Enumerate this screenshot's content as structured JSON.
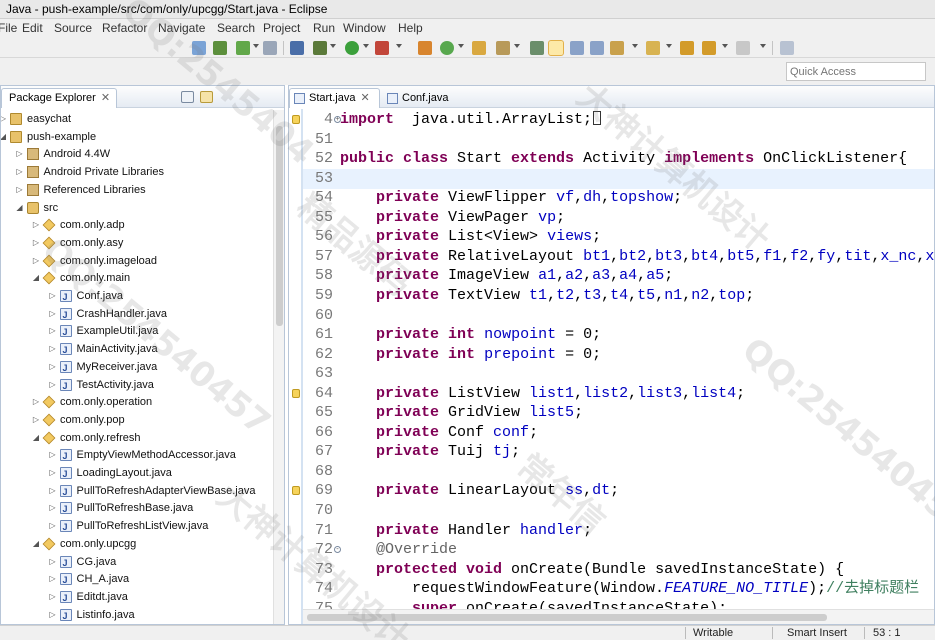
{
  "window": {
    "title": "Java - push-example/src/com/only/upcgg/Start.java - Eclipse"
  },
  "menu": [
    "File",
    "Edit",
    "Source",
    "Refactor",
    "Navigate",
    "Search",
    "Project",
    "Run",
    "Window",
    "Help"
  ],
  "toolbar": {
    "quick_access_placeholder": "Quick Access"
  },
  "package_explorer": {
    "tab_label": "Package Explorer",
    "close_glyph": "✕",
    "tree": [
      {
        "label": "easychat",
        "depth": 0,
        "icon": "project-icon",
        "expanded": false
      },
      {
        "label": "push-example",
        "depth": 0,
        "icon": "project-icon",
        "expanded": true
      },
      {
        "label": "Android 4.4W",
        "depth": 1,
        "icon": "library-icon",
        "expanded": false
      },
      {
        "label": "Android Private Libraries",
        "depth": 1,
        "icon": "library-icon",
        "expanded": false
      },
      {
        "label": "Referenced Libraries",
        "depth": 1,
        "icon": "library-icon",
        "expanded": false
      },
      {
        "label": "src",
        "depth": 1,
        "icon": "source-folder-icon",
        "expanded": true
      },
      {
        "label": "com.only.adp",
        "depth": 2,
        "icon": "package-icon",
        "expanded": false
      },
      {
        "label": "com.only.asy",
        "depth": 2,
        "icon": "package-icon",
        "expanded": false
      },
      {
        "label": "com.only.imageload",
        "depth": 2,
        "icon": "package-icon",
        "expanded": false
      },
      {
        "label": "com.only.main",
        "depth": 2,
        "icon": "package-icon",
        "expanded": true
      },
      {
        "label": "Conf.java",
        "depth": 3,
        "icon": "java-file-icon",
        "expanded": false
      },
      {
        "label": "CrashHandler.java",
        "depth": 3,
        "icon": "java-file-icon",
        "expanded": false
      },
      {
        "label": "ExampleUtil.java",
        "depth": 3,
        "icon": "java-file-icon",
        "expanded": false
      },
      {
        "label": "MainActivity.java",
        "depth": 3,
        "icon": "java-file-icon",
        "expanded": false
      },
      {
        "label": "MyReceiver.java",
        "depth": 3,
        "icon": "java-file-icon",
        "expanded": false
      },
      {
        "label": "TestActivity.java",
        "depth": 3,
        "icon": "java-file-icon",
        "expanded": false
      },
      {
        "label": "com.only.operation",
        "depth": 2,
        "icon": "package-icon",
        "expanded": false
      },
      {
        "label": "com.only.pop",
        "depth": 2,
        "icon": "package-icon",
        "expanded": false
      },
      {
        "label": "com.only.refresh",
        "depth": 2,
        "icon": "package-icon",
        "expanded": true
      },
      {
        "label": "EmptyViewMethodAccessor.java",
        "depth": 3,
        "icon": "java-file-icon",
        "expanded": false
      },
      {
        "label": "LoadingLayout.java",
        "depth": 3,
        "icon": "java-file-icon",
        "expanded": false
      },
      {
        "label": "PullToRefreshAdapterViewBase.java",
        "depth": 3,
        "icon": "java-file-icon",
        "expanded": false
      },
      {
        "label": "PullToRefreshBase.java",
        "depth": 3,
        "icon": "java-file-icon",
        "expanded": false
      },
      {
        "label": "PullToRefreshListView.java",
        "depth": 3,
        "icon": "java-file-icon",
        "expanded": false
      },
      {
        "label": "com.only.upcgg",
        "depth": 2,
        "icon": "package-icon",
        "expanded": true
      },
      {
        "label": "CG.java",
        "depth": 3,
        "icon": "java-file-icon",
        "expanded": false
      },
      {
        "label": "CH_A.java",
        "depth": 3,
        "icon": "java-file-icon",
        "expanded": false
      },
      {
        "label": "Editdt.java",
        "depth": 3,
        "icon": "java-file-icon",
        "expanded": false
      },
      {
        "label": "Listinfo.java",
        "depth": 3,
        "icon": "java-file-icon",
        "expanded": false
      }
    ]
  },
  "editor": {
    "tabs": [
      {
        "label": "Start.java",
        "active": true,
        "close_glyph": "✕"
      },
      {
        "label": "Conf.java",
        "active": false,
        "close_glyph": ""
      }
    ],
    "lines": [
      {
        "num": "4",
        "marker": true,
        "fold": "+",
        "current": false,
        "segs": [
          [
            "kw",
            "import"
          ],
          [
            "",
            "  java.util.ArrayList;"
          ]
        ],
        "cursor": true
      },
      {
        "num": "51",
        "marker": false,
        "fold": "",
        "current": false,
        "segs": []
      },
      {
        "num": "52",
        "marker": false,
        "fold": "",
        "current": false,
        "segs": [
          [
            "kw",
            "public class"
          ],
          [
            "",
            " Start "
          ],
          [
            "kw",
            "extends"
          ],
          [
            "",
            " Activity "
          ],
          [
            "kw",
            "implements"
          ],
          [
            "",
            " OnClickListener{"
          ]
        ]
      },
      {
        "num": "53",
        "marker": false,
        "fold": "",
        "current": true,
        "segs": []
      },
      {
        "num": "54",
        "marker": false,
        "fold": "",
        "current": false,
        "segs": [
          [
            "",
            "    "
          ],
          [
            "kw",
            "private"
          ],
          [
            "",
            " ViewFlipper "
          ],
          [
            "fld",
            "vf"
          ],
          [
            "",
            ","
          ],
          [
            "fld",
            "dh"
          ],
          [
            "",
            ","
          ],
          [
            "fld",
            "topshow"
          ],
          [
            "",
            ";"
          ]
        ]
      },
      {
        "num": "55",
        "marker": false,
        "fold": "",
        "current": false,
        "segs": [
          [
            "",
            "    "
          ],
          [
            "kw",
            "private"
          ],
          [
            "",
            " ViewPager "
          ],
          [
            "fld",
            "vp"
          ],
          [
            "",
            ";"
          ]
        ]
      },
      {
        "num": "56",
        "marker": false,
        "fold": "",
        "current": false,
        "segs": [
          [
            "",
            "    "
          ],
          [
            "kw",
            "private"
          ],
          [
            "",
            " List<View> "
          ],
          [
            "fld",
            "views"
          ],
          [
            "",
            ";"
          ]
        ]
      },
      {
        "num": "57",
        "marker": false,
        "fold": "",
        "current": false,
        "segs": [
          [
            "",
            "    "
          ],
          [
            "kw",
            "private"
          ],
          [
            "",
            " RelativeLayout "
          ],
          [
            "fld",
            "bt1"
          ],
          [
            "",
            ","
          ],
          [
            "fld",
            "bt2"
          ],
          [
            "",
            ","
          ],
          [
            "fld",
            "bt3"
          ],
          [
            "",
            ","
          ],
          [
            "fld",
            "bt4"
          ],
          [
            "",
            ","
          ],
          [
            "fld",
            "bt5"
          ],
          [
            "",
            ","
          ],
          [
            "fld",
            "f1"
          ],
          [
            "",
            ","
          ],
          [
            "fld",
            "f2"
          ],
          [
            "",
            ","
          ],
          [
            "fld",
            "fy"
          ],
          [
            "",
            ","
          ],
          [
            "fld",
            "tit"
          ],
          [
            "",
            ","
          ],
          [
            "fld",
            "x_nc"
          ],
          [
            "",
            ","
          ],
          [
            "fld",
            "x_"
          ]
        ]
      },
      {
        "num": "58",
        "marker": false,
        "fold": "",
        "current": false,
        "segs": [
          [
            "",
            "    "
          ],
          [
            "kw",
            "private"
          ],
          [
            "",
            " ImageView "
          ],
          [
            "fld",
            "a1"
          ],
          [
            "",
            ","
          ],
          [
            "fld",
            "a2"
          ],
          [
            "",
            ","
          ],
          [
            "fld",
            "a3"
          ],
          [
            "",
            ","
          ],
          [
            "fld",
            "a4"
          ],
          [
            "",
            ","
          ],
          [
            "fld",
            "a5"
          ],
          [
            "",
            ";"
          ]
        ]
      },
      {
        "num": "59",
        "marker": false,
        "fold": "",
        "current": false,
        "segs": [
          [
            "",
            "    "
          ],
          [
            "kw",
            "private"
          ],
          [
            "",
            " TextView "
          ],
          [
            "fld",
            "t1"
          ],
          [
            "",
            ","
          ],
          [
            "fld",
            "t2"
          ],
          [
            "",
            ","
          ],
          [
            "fld",
            "t3"
          ],
          [
            "",
            ","
          ],
          [
            "fld",
            "t4"
          ],
          [
            "",
            ","
          ],
          [
            "fld",
            "t5"
          ],
          [
            "",
            ","
          ],
          [
            "fld",
            "n1"
          ],
          [
            "",
            ","
          ],
          [
            "fld",
            "n2"
          ],
          [
            "",
            ","
          ],
          [
            "fld",
            "top"
          ],
          [
            "",
            ";"
          ]
        ]
      },
      {
        "num": "60",
        "marker": false,
        "fold": "",
        "current": false,
        "segs": []
      },
      {
        "num": "61",
        "marker": false,
        "fold": "",
        "current": false,
        "segs": [
          [
            "",
            "    "
          ],
          [
            "kw",
            "private int"
          ],
          [
            "",
            " "
          ],
          [
            "fld",
            "nowpoint"
          ],
          [
            "",
            " = 0;"
          ]
        ]
      },
      {
        "num": "62",
        "marker": false,
        "fold": "",
        "current": false,
        "segs": [
          [
            "",
            "    "
          ],
          [
            "kw",
            "private int"
          ],
          [
            "",
            " "
          ],
          [
            "fld",
            "prepoint"
          ],
          [
            "",
            " = 0;"
          ]
        ]
      },
      {
        "num": "63",
        "marker": false,
        "fold": "",
        "current": false,
        "segs": []
      },
      {
        "num": "64",
        "marker": true,
        "fold": "",
        "current": false,
        "segs": [
          [
            "",
            "    "
          ],
          [
            "kw",
            "private"
          ],
          [
            "",
            " ListView "
          ],
          [
            "fld",
            "list1"
          ],
          [
            "",
            ","
          ],
          [
            "fld",
            "list2"
          ],
          [
            "",
            ","
          ],
          [
            "fld",
            "list3"
          ],
          [
            "",
            ","
          ],
          [
            "fld",
            "list4"
          ],
          [
            "",
            ";"
          ]
        ]
      },
      {
        "num": "65",
        "marker": false,
        "fold": "",
        "current": false,
        "segs": [
          [
            "",
            "    "
          ],
          [
            "kw",
            "private"
          ],
          [
            "",
            " GridView "
          ],
          [
            "fld",
            "list5"
          ],
          [
            "",
            ";"
          ]
        ]
      },
      {
        "num": "66",
        "marker": false,
        "fold": "",
        "current": false,
        "segs": [
          [
            "",
            "    "
          ],
          [
            "kw",
            "private"
          ],
          [
            "",
            " Conf "
          ],
          [
            "fld",
            "conf"
          ],
          [
            "",
            ";"
          ]
        ]
      },
      {
        "num": "67",
        "marker": false,
        "fold": "",
        "current": false,
        "segs": [
          [
            "",
            "    "
          ],
          [
            "kw",
            "private"
          ],
          [
            "",
            " Tuij "
          ],
          [
            "fld",
            "tj"
          ],
          [
            "",
            ";"
          ]
        ]
      },
      {
        "num": "68",
        "marker": false,
        "fold": "",
        "current": false,
        "segs": []
      },
      {
        "num": "69",
        "marker": true,
        "fold": "",
        "current": false,
        "segs": [
          [
            "",
            "    "
          ],
          [
            "kw",
            "private"
          ],
          [
            "",
            " LinearLayout "
          ],
          [
            "fld",
            "ss"
          ],
          [
            "",
            ","
          ],
          [
            "fld",
            "dt"
          ],
          [
            "",
            ";"
          ]
        ]
      },
      {
        "num": "70",
        "marker": false,
        "fold": "",
        "current": false,
        "segs": []
      },
      {
        "num": "71",
        "marker": false,
        "fold": "",
        "current": false,
        "segs": [
          [
            "",
            "    "
          ],
          [
            "kw",
            "private"
          ],
          [
            "",
            " Handler "
          ],
          [
            "fld",
            "handler"
          ],
          [
            "",
            ";"
          ]
        ]
      },
      {
        "num": "72",
        "marker": false,
        "fold": "-",
        "current": false,
        "segs": [
          [
            "",
            "    "
          ],
          [
            "ann",
            "@Override"
          ]
        ]
      },
      {
        "num": "73",
        "marker": false,
        "fold": "",
        "current": false,
        "segs": [
          [
            "",
            "    "
          ],
          [
            "kw",
            "protected void"
          ],
          [
            "",
            " onCreate(Bundle savedInstanceState) {"
          ]
        ]
      },
      {
        "num": "74",
        "marker": false,
        "fold": "",
        "current": false,
        "segs": [
          [
            "",
            "        requestWindowFeature(Window."
          ],
          [
            "cst",
            "FEATURE_NO_TITLE"
          ],
          [
            "",
            ");"
          ],
          [
            "cmt",
            "//去掉标题栏"
          ]
        ]
      },
      {
        "num": "75",
        "marker": false,
        "fold": "",
        "current": false,
        "segs": [
          [
            "",
            "        "
          ],
          [
            "kw",
            "super"
          ],
          [
            "",
            ".onCreate(savedInstanceState);"
          ]
        ]
      }
    ]
  },
  "status": {
    "mode": "Writable",
    "insert": "Smart Insert",
    "position": "53 : 1"
  },
  "watermarks": [
    "QQ:2545404",
    "大神计算机设计",
    "精品源码",
    "常年信",
    "QQ:254540457"
  ]
}
